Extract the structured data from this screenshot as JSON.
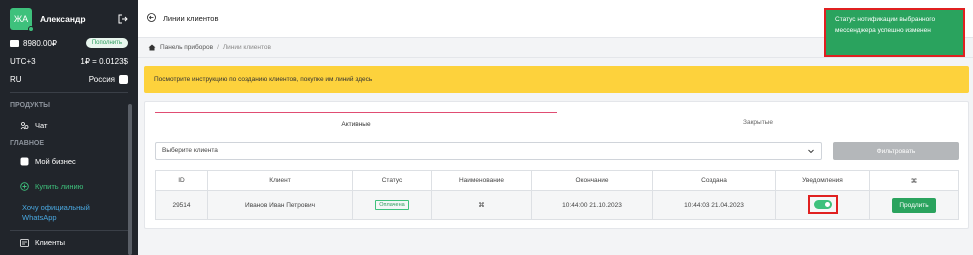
{
  "sidebar": {
    "avatar_initials": "ЖА",
    "user_name": "Александр",
    "balance": "8980.00₽",
    "topup_label": "Пополнить",
    "timezone": "UTC+3",
    "rate": "1₽ = 0.0123$",
    "language": "RU",
    "country": "Россия",
    "sections": {
      "products": "ПРОДУКТЫ",
      "main": "ГЛАВНОЕ"
    },
    "items": {
      "chat": "Чат",
      "my_business": "Мой бизнес",
      "buy_line": "Купить линию",
      "want_whatsapp_1": "Хочу официальный",
      "want_whatsapp_2": "WhatsApp",
      "clients": "Клиенты"
    }
  },
  "header": {
    "title": "Линии клиентов"
  },
  "toast": {
    "message": "Статус нотификации выбранного мессенджера успешно изменен"
  },
  "breadcrumb": {
    "home": "Панель приборов",
    "separator": "/",
    "current": "Линии клиентов"
  },
  "alert": {
    "text": "Посмотрите инструкцию по созданию клиентов, покупке им линий здесь"
  },
  "tabs": {
    "active": "Активные",
    "closed": "Закрытые"
  },
  "filter": {
    "select_placeholder": "Выберите клиента",
    "button": "Фильтровать"
  },
  "table": {
    "headers": {
      "id": "ID",
      "client": "Клиент",
      "status": "Статус",
      "name": "Наименование",
      "end": "Окончание",
      "created": "Создана",
      "notifications": "Уведомления",
      "actions": "⌘"
    },
    "rows": [
      {
        "id": "29514",
        "client": "Иванов Иван Петрович",
        "status": "Оплачена",
        "name": "⌘",
        "end": "10:44:00 21.10.2023",
        "created": "10:44:03 21.04.2023",
        "notifications_on": true,
        "action": "Продлить"
      }
    ]
  },
  "colors": {
    "sidebar_bg": "#21252b",
    "accent_green": "#3ec17c",
    "alert_yellow": "#fdd23c",
    "highlight_red": "#e02020",
    "tab_active_pink": "#e04d73"
  }
}
